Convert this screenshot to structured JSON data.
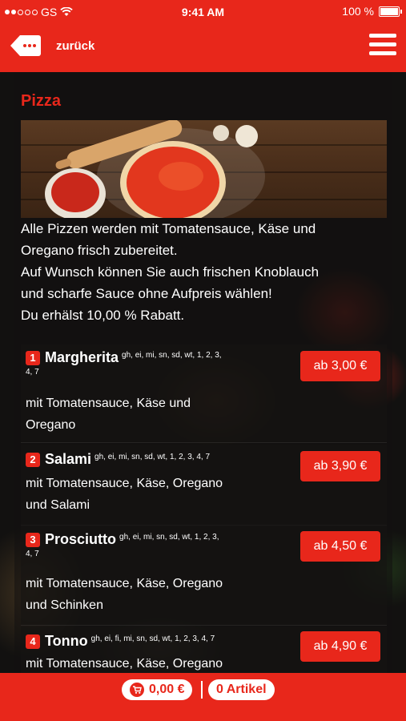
{
  "status_bar": {
    "carrier": "GS",
    "time": "9:41 AM",
    "battery": "100 %"
  },
  "nav": {
    "back_label": "zurück",
    "back_icon": "back-arrow-tag-icon",
    "menu_icon": "hamburger-menu-icon"
  },
  "category": {
    "title": "Pizza",
    "intro_lines": [
      "Alle Pizzen werden mit Tomatensauce, Käse und",
      "Oregano frisch zubereitet.",
      "Auf Wunsch können Sie auch frischen Knoblauch",
      "und scharfe Sauce ohne Aufpreis wählen!",
      "Du erhälst 10,00 % Rabatt."
    ]
  },
  "items": [
    {
      "number": "1",
      "name": "Margherita",
      "allergens": "gh, ei, mi, sn, sd, wt, 1, 2, 3,",
      "allergens_cont": "4, 7",
      "desc_line1": "mit Tomatensauce, Käse und",
      "desc_line2": "Oregano",
      "price": "ab 3,00 €"
    },
    {
      "number": "2",
      "name": "Salami",
      "allergens": "gh, ei, mi, sn, sd, wt, 1, 2, 3, 4, 7",
      "desc_line1": "mit Tomatensauce, Käse, Oregano",
      "desc_line2": "und Salami",
      "price": "ab 3,90 €"
    },
    {
      "number": "3",
      "name": "Prosciutto",
      "allergens": "gh, ei, mi, sn, sd, wt, 1, 2, 3,",
      "allergens_cont": "4, 7",
      "desc_line1": "mit Tomatensauce, Käse, Oregano",
      "desc_line2": "und Schinken",
      "price": "ab 4,50 €"
    },
    {
      "number": "4",
      "name": "Tonno",
      "allergens": "gh, ei, fi, mi, sn, sd, wt, 1, 2, 3, 4, 7",
      "desc_line1": "mit Tomatensauce, Käse, Oregano",
      "price": "ab 4,90 €"
    }
  ],
  "cart": {
    "total": "0,00 €",
    "count": "0 Artikel",
    "cart_icon": "shopping-cart-icon"
  },
  "colors": {
    "brand_red": "#e8271b",
    "text": "#ffffff"
  }
}
